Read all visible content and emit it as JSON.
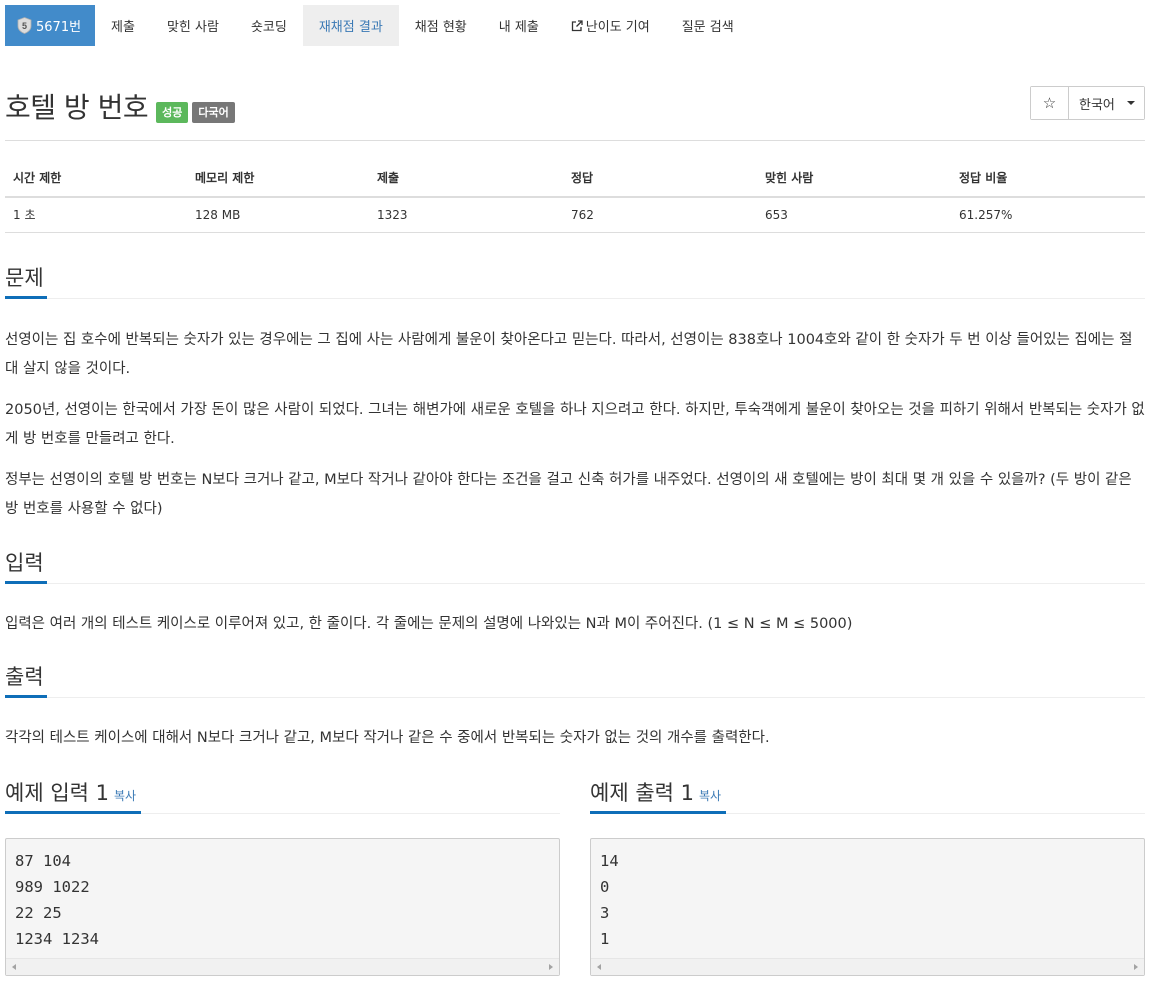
{
  "nav": {
    "problem_number": "5671번",
    "items": [
      {
        "label": "제출"
      },
      {
        "label": "맞힌 사람"
      },
      {
        "label": "숏코딩"
      },
      {
        "label": "재채점 결과"
      },
      {
        "label": "채점 현황"
      },
      {
        "label": "내 제출"
      },
      {
        "label": "난이도 기여"
      },
      {
        "label": "질문 검색"
      }
    ],
    "active_index": 3,
    "badge_text": "5",
    "badge_color": "#e0e0e0"
  },
  "problem": {
    "title": "호텔 방 번호",
    "labels": [
      "성공",
      "다국어"
    ]
  },
  "toolbar": {
    "star": "☆",
    "language": "한국어"
  },
  "info": {
    "headers": [
      "시간 제한",
      "메모리 제한",
      "제출",
      "정답",
      "맞힌 사람",
      "정답 비율"
    ],
    "values": [
      "1 초",
      "128 MB",
      "1323",
      "762",
      "653",
      "61.257%"
    ]
  },
  "sections": {
    "description_title": "문제",
    "description": [
      "선영이는 집 호수에 반복되는 숫자가 있는 경우에는 그 집에 사는 사람에게 불운이 찾아온다고 믿는다. 따라서, 선영이는 838호나 1004호와 같이 한 숫자가 두 번 이상 들어있는 집에는 절대 살지 않을 것이다.",
      "2050년, 선영이는 한국에서 가장 돈이 많은 사람이 되었다. 그녀는 해변가에 새로운 호텔을 하나 지으려고 한다. 하지만, 투숙객에게 불운이 찾아오는 것을 피하기 위해서 반복되는 숫자가 없게 방 번호를 만들려고 한다.",
      "정부는 선영이의 호텔 방 번호는 N보다 크거나 같고, M보다 작거나 같아야 한다는 조건을 걸고 신축 허가를 내주었다. 선영이의 새 호텔에는 방이 최대 몇 개 있을 수 있을까? (두 방이 같은 방 번호를 사용할 수 없다)"
    ],
    "input_title": "입력",
    "input": "입력은 여러 개의 테스트 케이스로 이루어져 있고, 한 줄이다. 각 줄에는 문제의 설명에 나와있는 N과 M이 주어진다. (1 ≤ N ≤ M ≤ 5000)",
    "output_title": "출력",
    "output": "각각의 테스트 케이스에 대해서 N보다 크거나 같고, M보다 작거나 같은 수 중에서 반복되는 숫자가 없는 것의 개수를 출력한다."
  },
  "samples": {
    "input_title": "예제 입력 1",
    "output_title": "예제 출력 1",
    "copy_label": "복사",
    "input_text": "87 104\n989 1022\n22 25\n1234 1234",
    "output_text": "14\n0\n3\n1"
  },
  "colors": {
    "primary": "#428bca",
    "success": "#5cb85c",
    "default_label": "#777777",
    "section_underline": "#0e6eb8"
  }
}
